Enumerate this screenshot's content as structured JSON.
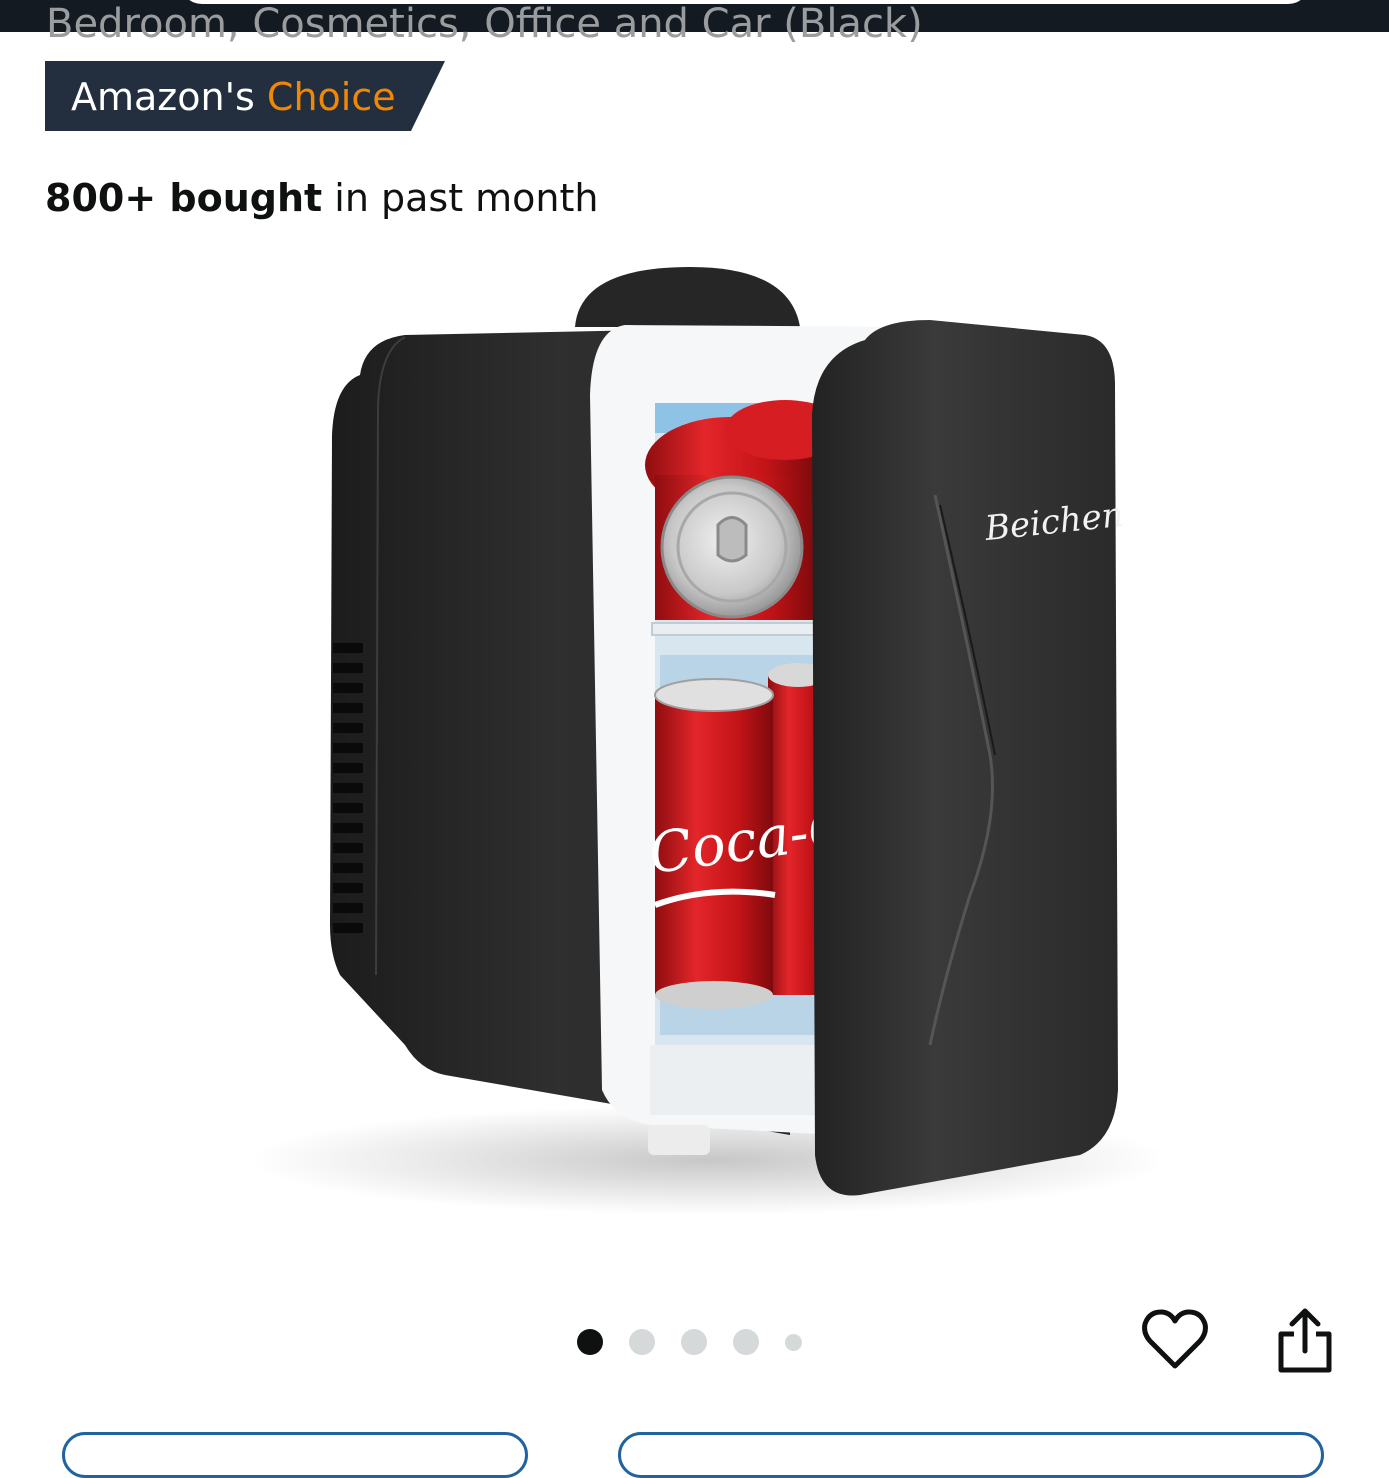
{
  "header": {
    "cut_title": "Bedroom, Cosmetics, Office and Car (Black)"
  },
  "badge": {
    "amazons": "Amazon's",
    "choice": "Choice",
    "colors": {
      "background": "#232f3e",
      "choice": "#f08804"
    }
  },
  "social_proof": {
    "count": "800+ bought",
    "suffix": "in past month"
  },
  "gallery": {
    "image": {
      "brand_label": "Beichen",
      "can_label": "Coca-Cola"
    },
    "dots": {
      "count": 5,
      "active": 0
    }
  },
  "actions": {
    "favorite_icon": "heart-icon",
    "share_icon": "share-icon"
  }
}
